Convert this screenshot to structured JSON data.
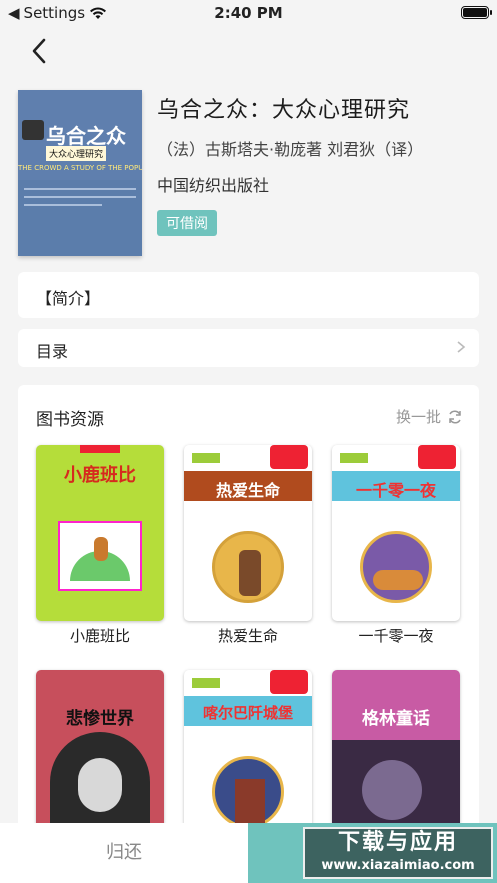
{
  "status_bar": {
    "carrier": "Settings",
    "time": "2:40 PM"
  },
  "book": {
    "cover_title": "乌合之众",
    "cover_subtitle": "大众心理研究",
    "cover_english": "THE CROWD A STUDY OF THE POPULAR MIND",
    "title": "乌合之众：大众心理研究",
    "author": "（法）古斯塔夫·勒庞著 刘君狄（译）",
    "publisher": "中国纺织出版社",
    "availability": "可借阅"
  },
  "sections": {
    "intro_label": "【简介】",
    "toc_label": "目录"
  },
  "resources": {
    "heading": "图书资源",
    "refresh_label": "换一批",
    "books": [
      {
        "label": "小鹿班比",
        "cover_text": "小鹿班比",
        "bg": "#b5dd3a"
      },
      {
        "label": "热爱生命",
        "cover_text": "热爱生命",
        "bg": "#ffffff"
      },
      {
        "label": "一千零一夜",
        "cover_text": "一千零一夜",
        "bg": "#ffffff"
      },
      {
        "label": "",
        "cover_text": "悲惨世界",
        "bg": "#c74f5c"
      },
      {
        "label": "",
        "cover_text": "喀尔巴阡城堡",
        "bg": "#ffffff"
      },
      {
        "label": "",
        "cover_text": "格林童话",
        "bg": "#c85ba4"
      }
    ]
  },
  "bottom_bar": {
    "return_label": "归还"
  },
  "watermark": {
    "line1": "下载与应用",
    "line2": "www.xiazaimiao.com"
  }
}
